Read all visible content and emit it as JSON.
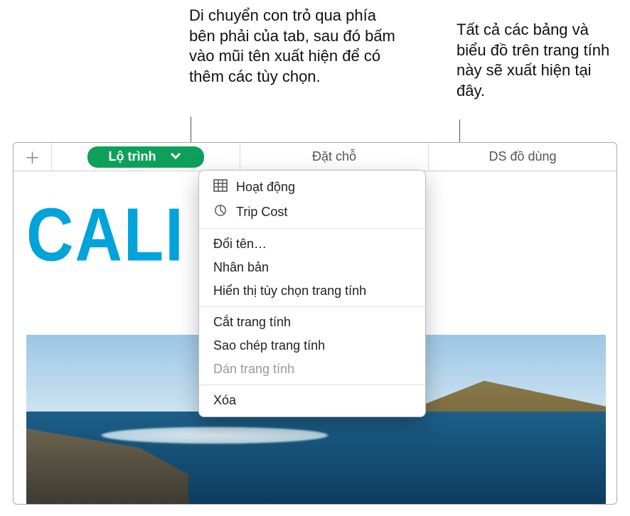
{
  "callouts": {
    "left": "Di chuyển con trỏ qua phía bên phải của tab, sau đó bấm vào mũi tên xuất hiện để có thêm các tùy chọn.",
    "right": "Tất cả các bảng và biểu đồ trên trang tính này sẽ xuất hiện tại đây."
  },
  "tabs": {
    "active": "Lộ trình",
    "center": "Đặt chỗ",
    "right": "DS đồ dùng"
  },
  "menu": {
    "section_objects": [
      {
        "label": "Hoạt động",
        "icon": "table-icon"
      },
      {
        "label": "Trip Cost",
        "icon": "chart-icon"
      }
    ],
    "actions1": [
      "Đổi tên…",
      "Nhân bản",
      "Hiển thị tùy chọn trang tính"
    ],
    "actions2": [
      {
        "label": "Cắt trang tính",
        "disabled": false
      },
      {
        "label": "Sao chép trang tính",
        "disabled": false
      },
      {
        "label": "Dán trang tính",
        "disabled": true
      }
    ],
    "delete": "Xóa"
  },
  "document": {
    "title_graphic": "CALI"
  }
}
